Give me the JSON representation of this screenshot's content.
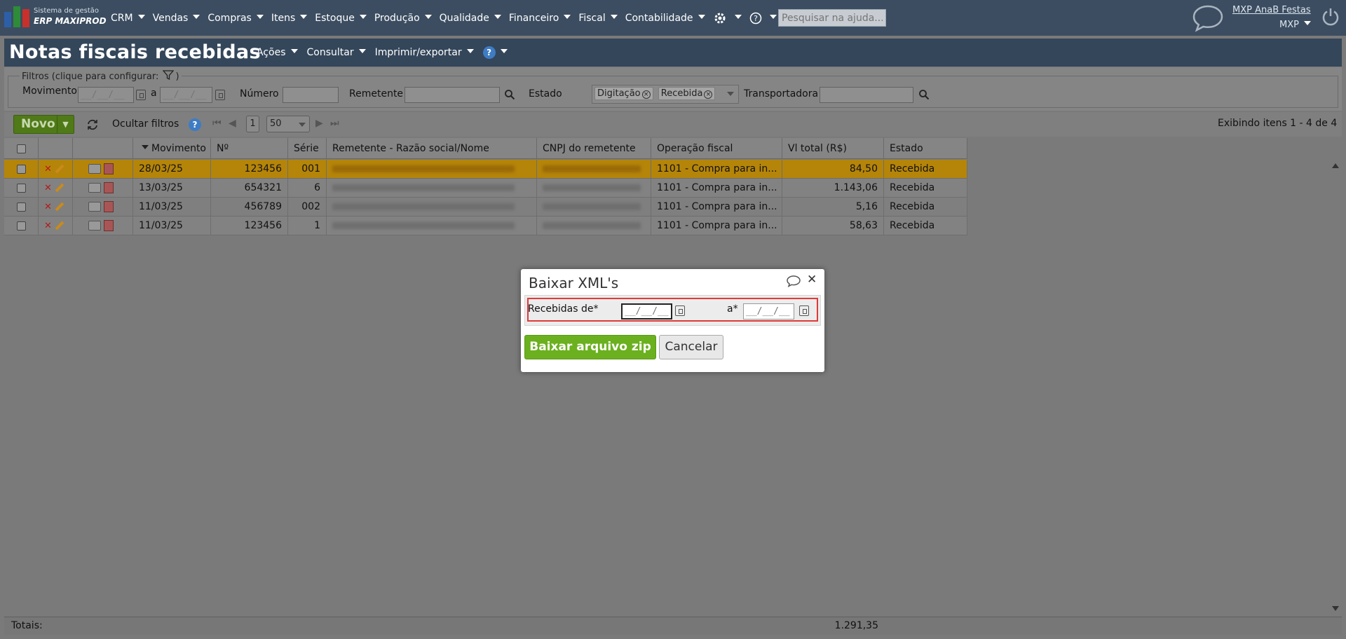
{
  "topnav": {
    "logo_line1": "Sistema de gestão",
    "logo_line2": "ERP MAXIPROD",
    "menu": [
      "CRM",
      "Vendas",
      "Compras",
      "Itens",
      "Estoque",
      "Produção",
      "Qualidade",
      "Financeiro",
      "Fiscal",
      "Contabilidade"
    ],
    "settings_icon": "gear-icon",
    "help_icon": "question-circle-icon",
    "help_search_placeholder": "Pesquisar na ajuda...",
    "user_name": "MXP AnaB Festas",
    "org": "MXP"
  },
  "page": {
    "title": "Notas fiscais recebidas",
    "menu": [
      "Ações",
      "Consultar",
      "Imprimir/exportar"
    ],
    "help": "?"
  },
  "filters": {
    "legend": "Filtros (clique para configurar:",
    "legend_close": ")",
    "movimento_label": "Movimento",
    "date_mask": "__/__/__",
    "a_label": "a",
    "numero_label": "Número",
    "remetente_label": "Remetente",
    "estado_label": "Estado",
    "estado_chips": [
      "Digitação",
      "Recebida"
    ],
    "transportadora_label": "Transportadora"
  },
  "toolbar": {
    "novo_label": "Novo",
    "ocultar_label": "Ocultar filtros",
    "page_number": "1",
    "page_size": "50",
    "showing": "Exibindo itens 1 - 4 de 4"
  },
  "grid": {
    "columns": [
      "Movimento",
      "Nº",
      "Série",
      "Remetente - Razão social/Nome",
      "CNPJ do remetente",
      "Operação fiscal",
      "Vl total (R$)",
      "Estado"
    ],
    "rows": [
      {
        "movimento": "28/03/25",
        "numero": "123456",
        "serie": "001",
        "operacao": "1101 - Compra para in...",
        "total": "84,50",
        "estado": "Recebida"
      },
      {
        "movimento": "13/03/25",
        "numero": "654321",
        "serie": "6",
        "operacao": "1101 - Compra para in...",
        "total": "1.143,06",
        "estado": "Recebida"
      },
      {
        "movimento": "11/03/25",
        "numero": "456789",
        "serie": "002",
        "operacao": "1101 - Compra para in...",
        "total": "5,16",
        "estado": "Recebida"
      },
      {
        "movimento": "11/03/25",
        "numero": "123456",
        "serie": "1",
        "operacao": "1101 - Compra para in...",
        "total": "58,63",
        "estado": "Recebida"
      }
    ],
    "totals_label": "Totais:",
    "totals_value": "1.291,35"
  },
  "modal": {
    "title": "Baixar XML's",
    "from_label": "Recebidas de*",
    "to_label": "a*",
    "date_mask": "__/__/__",
    "download_label": "Baixar arquivo zip",
    "cancel_label": "Cancelar"
  },
  "colors": {
    "topnav": "#3c4d61",
    "selected_row": "#b58509",
    "primary_button": "#6bb01e",
    "highlight_border": "#e03a3a"
  }
}
